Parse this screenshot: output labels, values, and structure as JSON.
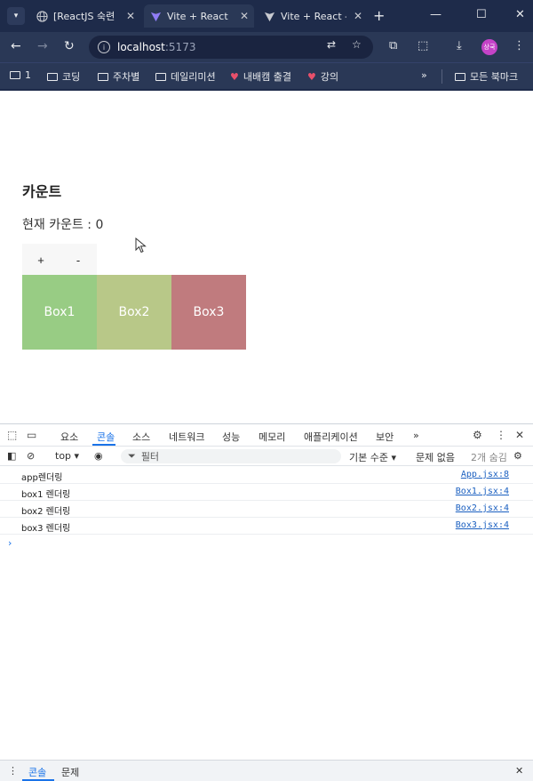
{
  "browser": {
    "tabs": [
      {
        "title": "[ReactJS 숙련",
        "icon": "globe-icon",
        "active": false
      },
      {
        "title": "Vite + React",
        "icon": "vite-icon",
        "active": true
      },
      {
        "title": "Vite + React -",
        "icon": "vite-dim-icon",
        "active": false
      }
    ],
    "url_host": "localhost",
    "url_port": ":5173",
    "profile_label": "상국",
    "bookmarks": [
      {
        "label": "1",
        "icon": "folder"
      },
      {
        "label": "코딩",
        "icon": "folder"
      },
      {
        "label": "주차별",
        "icon": "folder"
      },
      {
        "label": "데일리미션",
        "icon": "folder"
      },
      {
        "label": "내배캠 출결",
        "icon": "heart"
      },
      {
        "label": "강의",
        "icon": "heart"
      }
    ],
    "more_bookmarks": "»",
    "all_bookmarks": "모든 북마크"
  },
  "app": {
    "heading": "카운트",
    "count_label": "현재 카운트 : 0",
    "plus_label": "+",
    "minus_label": "-",
    "boxes": [
      {
        "label": "Box1",
        "color": "#98cc84"
      },
      {
        "label": "Box2",
        "color": "#b8c888"
      },
      {
        "label": "Box3",
        "color": "#c07b7e"
      }
    ]
  },
  "devtools": {
    "tabs": [
      "요소",
      "콘솔",
      "소스",
      "네트워크",
      "성능",
      "메모리",
      "애플리케이션",
      "보안",
      "»"
    ],
    "active_tab": "콘솔",
    "context": "top ▾",
    "filter_placeholder": "필터",
    "level": "기본 수준 ▾",
    "issues": "문제 없음",
    "hidden": "2개 숨김",
    "logs": [
      {
        "message": "app렌더링",
        "source": "App.jsx:8"
      },
      {
        "message": "box1 렌더링",
        "source": "Box1.jsx:4"
      },
      {
        "message": "box2 렌더링",
        "source": "Box2.jsx:4"
      },
      {
        "message": "box3 렌더링",
        "source": "Box3.jsx:4"
      }
    ],
    "drawer_tabs": [
      "콘솔",
      "문제"
    ]
  },
  "colors": {
    "chrome_bg": "#1e2b4a",
    "accent": "#1a73e8"
  }
}
